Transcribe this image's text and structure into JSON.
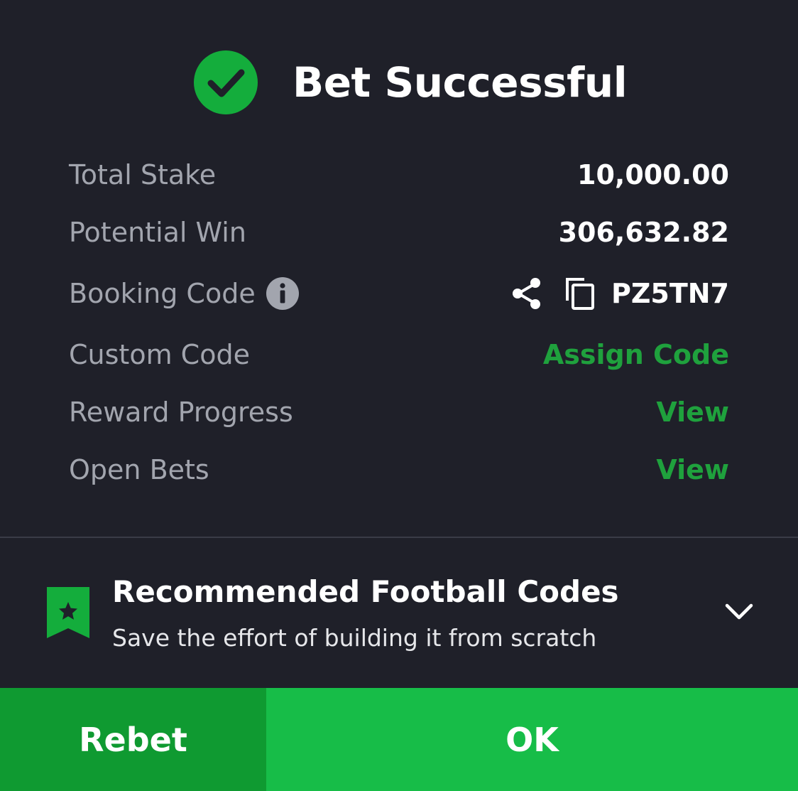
{
  "header": {
    "title": "Bet Successful",
    "icon": "check-circle-icon"
  },
  "details": {
    "total_stake": {
      "label": "Total Stake",
      "value": "10,000.00"
    },
    "potential_win": {
      "label": "Potential Win",
      "value": "306,632.82"
    },
    "booking_code": {
      "label": "Booking Code",
      "value": "PZ5TN7",
      "icons": [
        "info-icon",
        "share-icon",
        "copy-icon"
      ]
    },
    "custom_code": {
      "label": "Custom Code",
      "action": "Assign Code"
    },
    "reward_progress": {
      "label": "Reward Progress",
      "action": "View"
    },
    "open_bets": {
      "label": "Open Bets",
      "action": "View"
    }
  },
  "recommendation": {
    "title": "Recommended Football Codes",
    "subtitle": "Save the effort of building it from scratch",
    "icons": [
      "bookmark-star-icon",
      "chevron-down-icon"
    ]
  },
  "footer": {
    "rebet_label": "Rebet",
    "ok_label": "OK"
  },
  "colors": {
    "background": "#1f2029",
    "accent_green": "#1fa13d",
    "rebet_bg": "#0f9a31",
    "ok_bg": "#17bd48",
    "label_gray": "#a2a5ae"
  }
}
